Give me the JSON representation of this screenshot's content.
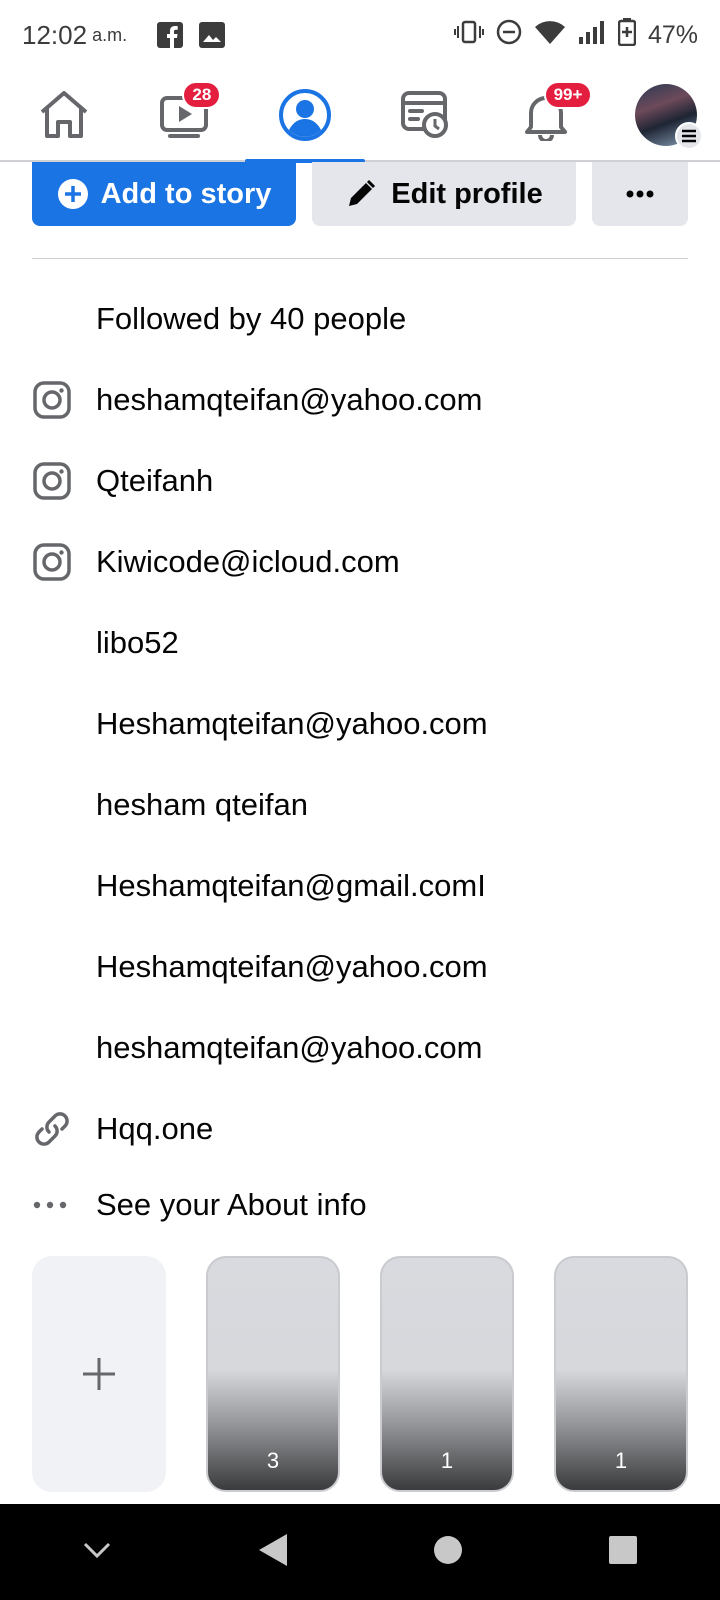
{
  "status_bar": {
    "time": "12:02",
    "ampm": "a.m.",
    "battery": "47%"
  },
  "top_nav": {
    "items": [
      {
        "name": "home",
        "badge": ""
      },
      {
        "name": "watch",
        "badge": "28"
      },
      {
        "name": "profile",
        "badge": "",
        "active": true
      },
      {
        "name": "feeds",
        "badge": ""
      },
      {
        "name": "notifications",
        "badge": "99+"
      },
      {
        "name": "menu",
        "badge": ""
      }
    ]
  },
  "actions": {
    "add_story": "Add to story",
    "edit_profile": "Edit profile",
    "more": "···"
  },
  "info": {
    "followed_by": "Followed by 40 people",
    "instagram_1": "heshamqteifan@yahoo.com",
    "instagram_2": "Qteifanh",
    "instagram_3": "Kiwicode@icloud.com",
    "line_1": "libo52",
    "line_2": "Heshamqteifan@yahoo.com",
    "line_3": "hesham qteifan",
    "line_4": "Heshamqteifan@gmail.comI",
    "line_5": "Heshamqteifan@yahoo.com",
    "line_6": "heshamqteifan@yahoo.com",
    "link": "Hqq.one",
    "see_about": "See your About info"
  },
  "stories": {
    "counts": [
      "3",
      "1",
      "1"
    ]
  },
  "colors": {
    "accent": "#1b74e4",
    "badge": "#e41e3f"
  }
}
